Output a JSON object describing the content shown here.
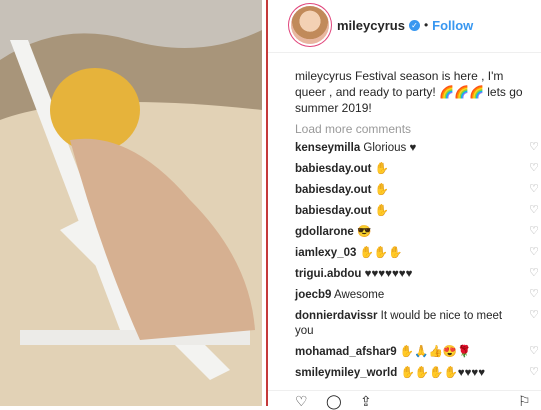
{
  "post": {
    "username": "mileycyrus",
    "follow_label": "Follow",
    "separator": "•",
    "caption_user": "mileycyrus",
    "caption_text": "Festival season is here , I'm queer , and ready to party! 🌈🌈🌈 lets go summer 2019!",
    "load_more": "Load more comments"
  },
  "comments": [
    {
      "user": "kenseymilla",
      "text": "Glorious ♥"
    },
    {
      "user": "babiesday.out",
      "text": "✋"
    },
    {
      "user": "babiesday.out",
      "text": "✋"
    },
    {
      "user": "babiesday.out",
      "text": "✋"
    },
    {
      "user": "gdollarone",
      "text": "😎"
    },
    {
      "user": "iamlexy_03",
      "text": "✋✋✋"
    },
    {
      "user": "trigui.abdou",
      "text": "♥♥♥♥♥♥♥"
    },
    {
      "user": "joecb9",
      "text": "Awesome"
    },
    {
      "user": "donnierdavissr",
      "text": "It would be nice to meet you"
    },
    {
      "user": "mohamad_afshar9",
      "text": "✋🙏👍😍🌹"
    },
    {
      "user": "smileymiley_world",
      "text": "✋✋✋✋♥♥♥♥"
    }
  ],
  "icons": {
    "heart": "♡",
    "like": "♡",
    "comment": "◯",
    "share": "⇪",
    "save": "⚐"
  }
}
